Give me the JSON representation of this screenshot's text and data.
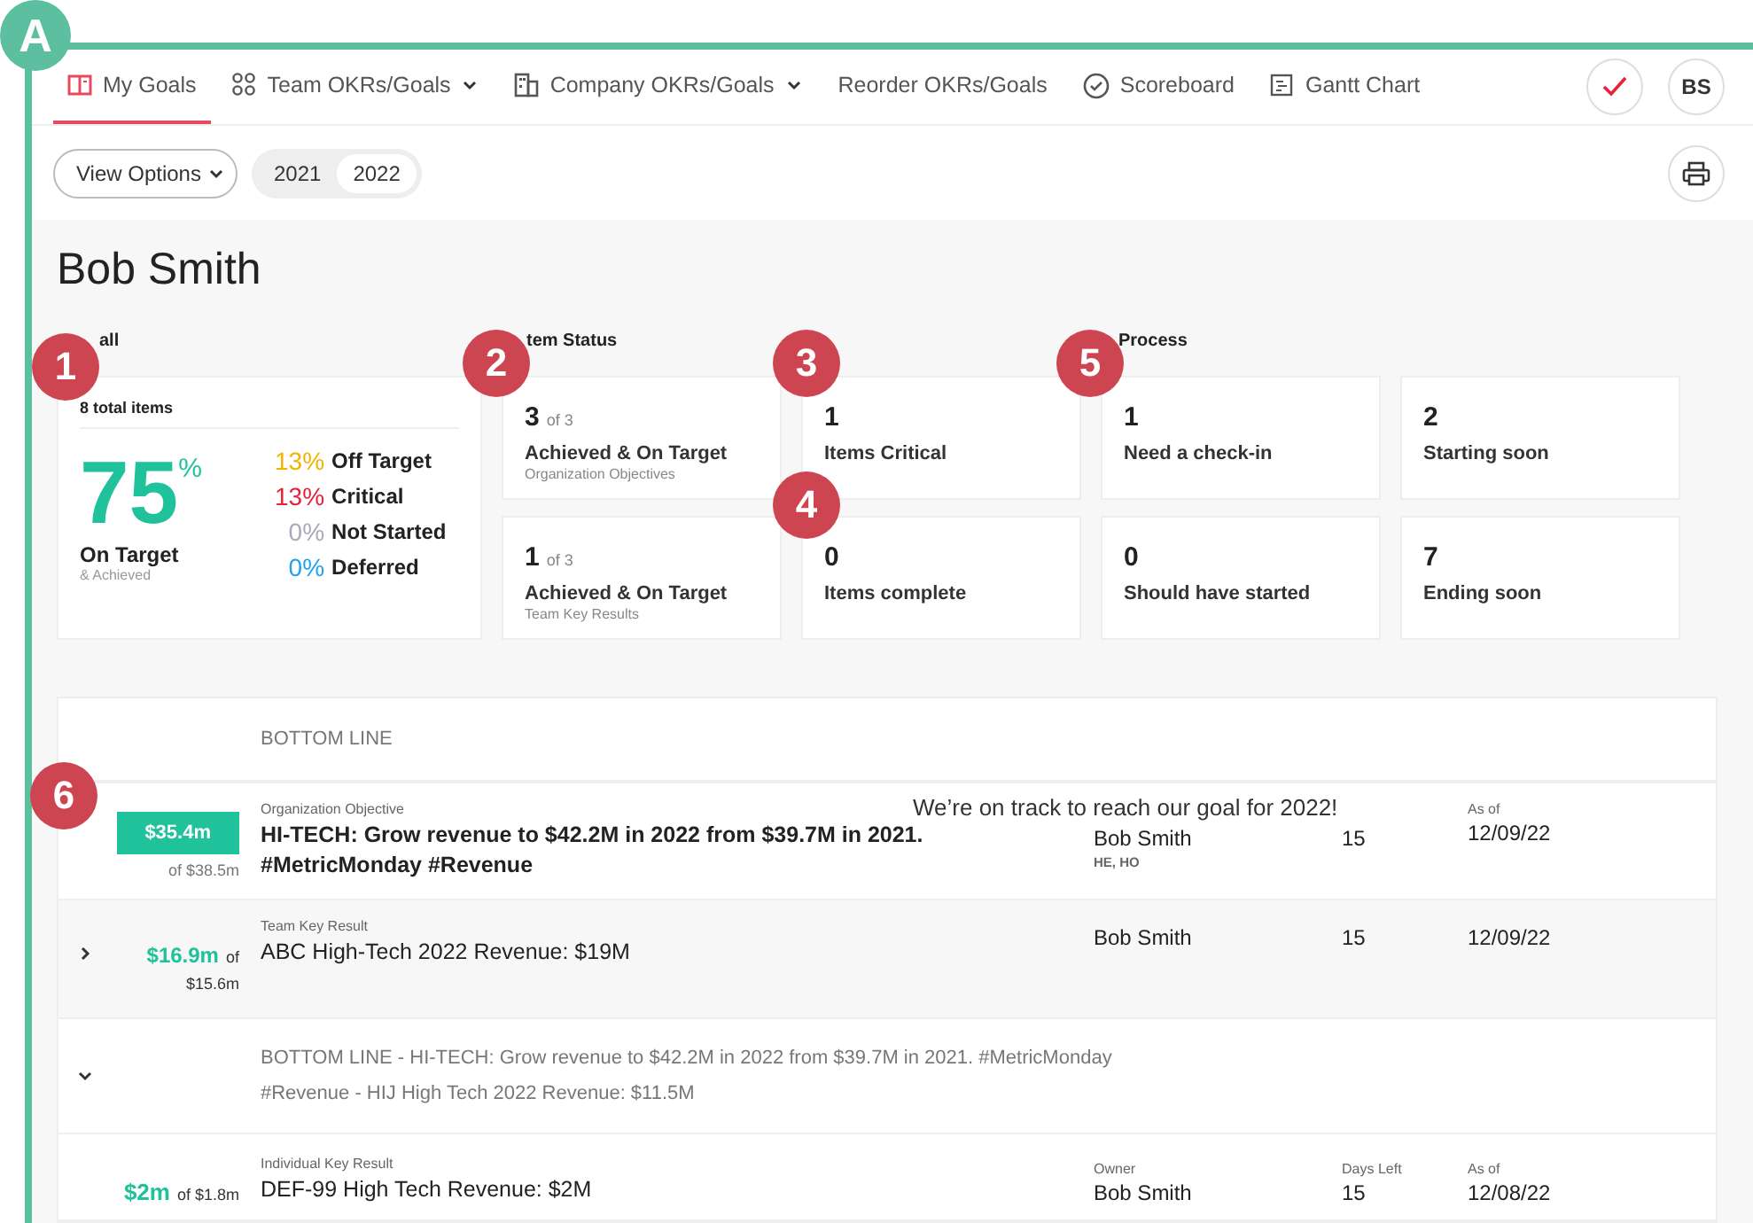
{
  "frame_badge": "A",
  "nav": {
    "tabs": [
      {
        "label": "My Goals",
        "selected": true,
        "has_menu": false
      },
      {
        "label": "Team OKRs/Goals",
        "selected": false,
        "has_menu": true
      },
      {
        "label": "Company OKRs/Goals",
        "selected": false,
        "has_menu": true
      },
      {
        "label": "Reorder OKRs/Goals",
        "selected": false,
        "has_menu": false
      },
      {
        "label": "Scoreboard",
        "selected": false,
        "has_menu": false
      },
      {
        "label": "Gantt Chart",
        "selected": false,
        "has_menu": false
      }
    ],
    "avatar": "BS"
  },
  "toolbar": {
    "view_options": "View Options",
    "years": [
      {
        "label": "2021",
        "selected": false
      },
      {
        "label": "2022",
        "selected": true
      }
    ]
  },
  "person": "Bob Smith",
  "overall": {
    "heading": "all",
    "total": "8 total items",
    "percent": "75",
    "percent_sign": "%",
    "main_label": "On Target",
    "sub_label": "& Achieved",
    "legend": [
      {
        "pct": "13%",
        "label": "Off Target",
        "color": "#f0b400"
      },
      {
        "pct": "13%",
        "label": "Critical",
        "color": "#e8213a"
      },
      {
        "pct": "0%",
        "label": "Not Started",
        "color": "#a9a9bb"
      },
      {
        "pct": "0%",
        "label": "Deferred",
        "color": "#1ea1f2"
      }
    ]
  },
  "item_status": {
    "heading": "tem Status",
    "cards": [
      {
        "value": "3",
        "of": "of 3",
        "label": "Achieved & On Target",
        "sub": "Organization Objectives"
      },
      {
        "value": "1",
        "of": "of 3",
        "label": "Achieved & On Target",
        "sub": "Team Key Results"
      }
    ]
  },
  "column_3": {
    "cards": [
      {
        "value": "1",
        "label": "Items Critical"
      },
      {
        "value": "0",
        "label": "Items complete"
      }
    ]
  },
  "process": {
    "heading": "Process",
    "cards": [
      {
        "value": "1",
        "label": "Need a check-in"
      },
      {
        "value": "2",
        "label": "Starting soon"
      },
      {
        "value": "0",
        "label": "Should have started"
      },
      {
        "value": "7",
        "label": "Ending soon"
      }
    ]
  },
  "table": {
    "heading": "BOTTOM LINE",
    "rows": [
      {
        "kind": "objective",
        "amount": "$35.4m",
        "of": "of $38.5m",
        "type": "Organization Objective",
        "title": "HI-TECH: Grow revenue to $42.2M in 2022 from $39.7M in 2021. #MetricMonday #Revenue",
        "owner": "Bob Smith",
        "owner_sub": "HE, HO",
        "days": "15",
        "as_of_label": "As of",
        "as_of": "12/09/22",
        "tooltip": "We’re on track to reach our goal for 2022!"
      },
      {
        "kind": "team",
        "expanded": false,
        "amount": "$16.9m",
        "of": "of",
        "of_value": "$15.6m",
        "type": "Team Key Result",
        "title": "ABC High-Tech 2022 Revenue: $19M",
        "owner": "Bob Smith",
        "days": "15",
        "as_of": "12/09/22"
      },
      {
        "kind": "group",
        "expanded": true,
        "title": "BOTTOM LINE - HI-TECH: Grow revenue to $42.2M in 2022 from $39.7M in 2021. #MetricMonday #Revenue - HIJ High Tech 2022 Revenue: $11.5M"
      },
      {
        "kind": "individual",
        "amount": "$2m",
        "of": "of $1.8m",
        "type": "Individual Key Result",
        "title": "DEF-99 High Tech Revenue: $2M",
        "owner_label": "Owner",
        "owner": "Bob Smith",
        "days_label": "Days Left",
        "days": "15",
        "as_of_label": "As of",
        "as_of": "12/08/22"
      }
    ]
  },
  "callouts": [
    {
      "label": "1"
    },
    {
      "label": "2"
    },
    {
      "label": "3"
    },
    {
      "label": "4"
    },
    {
      "label": "5"
    },
    {
      "label": "6"
    }
  ]
}
